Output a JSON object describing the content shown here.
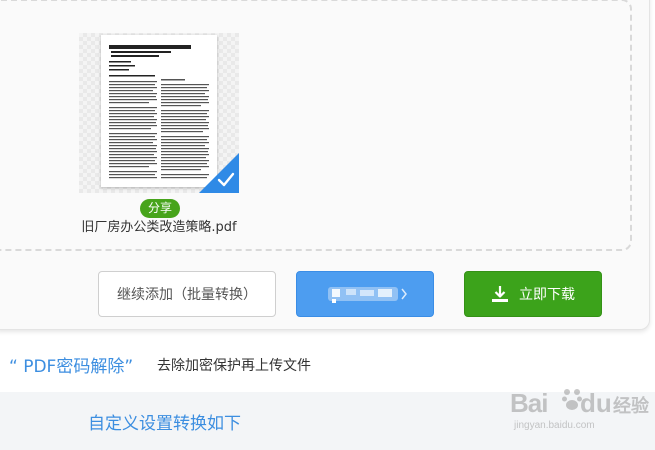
{
  "file": {
    "share_label": "分享",
    "name": "旧厂房办公类改造策略.pdf"
  },
  "buttons": {
    "continue_label": "继续添加（批量转换）",
    "download_label": "立即下载"
  },
  "pdf_unlock": {
    "link_text": "“ PDF密码解除”",
    "description": "去除加密保护再上传文件"
  },
  "custom_settings": {
    "link_text": "自定义设置转换如下"
  },
  "watermark": {
    "brand_left": "Bai",
    "brand_right": "du",
    "brand_cn": "经验",
    "url": "jingyan.baidu.com"
  },
  "colors": {
    "accent_blue": "#3c8ee0",
    "download_green": "#3ca31b",
    "check_blue": "#2f8ae6",
    "share_green": "#47a41b"
  },
  "icons": [
    "check-icon",
    "download-icon",
    "baidu-paw-icon"
  ]
}
